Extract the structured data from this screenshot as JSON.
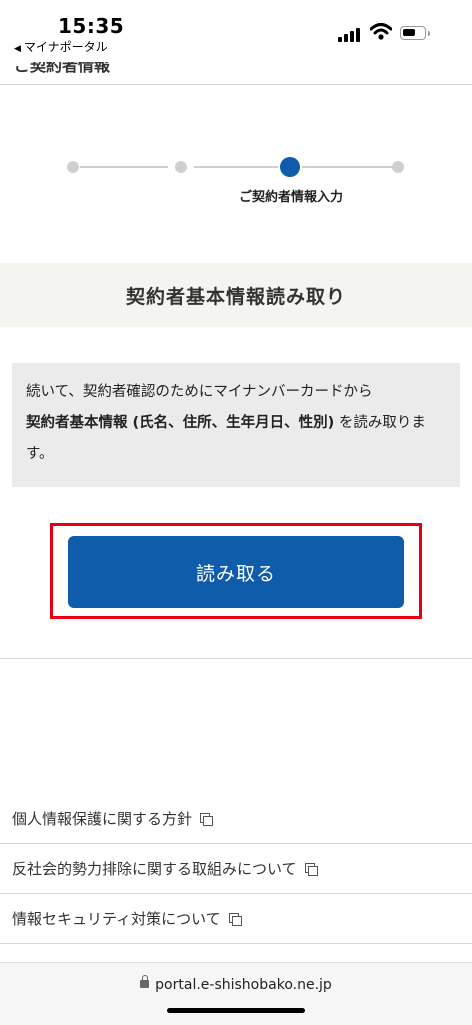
{
  "status_bar": {
    "time": "15:35",
    "back_app": "マイナポータル"
  },
  "header": {
    "cut_text": "ご契約者情報"
  },
  "stepper": {
    "steps": 4,
    "active_step": 3,
    "active_label": "ご契約者情報入力",
    "active_color": "#0f5cab"
  },
  "section": {
    "title": "契約者基本情報読み取り"
  },
  "info": {
    "line1": "続いて、契約者確認のためにマイナンバーカードから",
    "bold": "契約者基本情報 (氏名、住所、生年月日、性別)",
    "line2_tail": " を読み取ります。"
  },
  "read_button": {
    "label": "読み取る",
    "color": "#0f5cab",
    "highlight_color": "#e60012"
  },
  "footer": {
    "links": [
      "個人情報保護に関する方針",
      "反社会的勢力排除に関する取組みについて",
      "情報セキュリティ対策について"
    ],
    "link_icon": "external-window-icon"
  },
  "browser": {
    "url": "portal.e-shishobako.ne.jp"
  }
}
